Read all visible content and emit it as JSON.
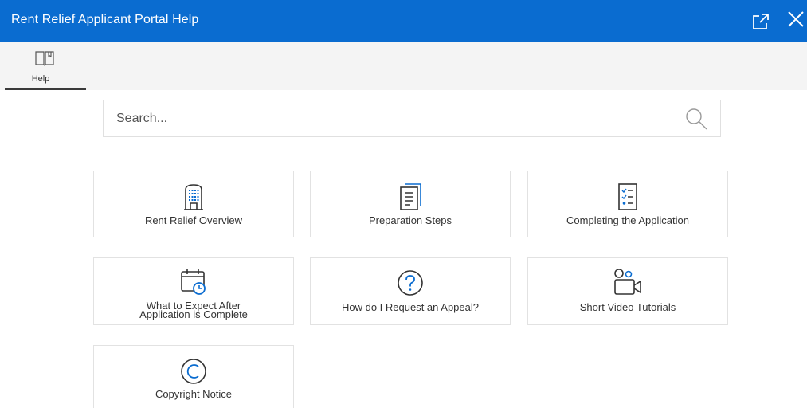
{
  "window": {
    "title": "Rent Relief Applicant Portal Help"
  },
  "tabs": [
    {
      "label": "Help",
      "icon": "book-icon",
      "selected": true
    }
  ],
  "search": {
    "placeholder": "Search...",
    "value": ""
  },
  "cards": [
    {
      "label": "Rent Relief Overview",
      "icon": "building-icon"
    },
    {
      "label": "Preparation Steps",
      "icon": "document-icon"
    },
    {
      "label": "Completing the Application",
      "icon": "checklist-icon"
    },
    {
      "label_lines": [
        "What to Expect After",
        "Application is Complete"
      ],
      "icon": "calendar-clock-icon"
    },
    {
      "label": "How do I Request an Appeal?",
      "icon": "question-icon"
    },
    {
      "label": "Short Video Tutorials",
      "icon": "video-camera-icon"
    },
    {
      "label": "Copyright Notice",
      "icon": "copyright-icon"
    }
  ],
  "colors": {
    "header": "#0a6cd0",
    "accent": "#0a6cd0",
    "icon_dark": "#333333"
  }
}
